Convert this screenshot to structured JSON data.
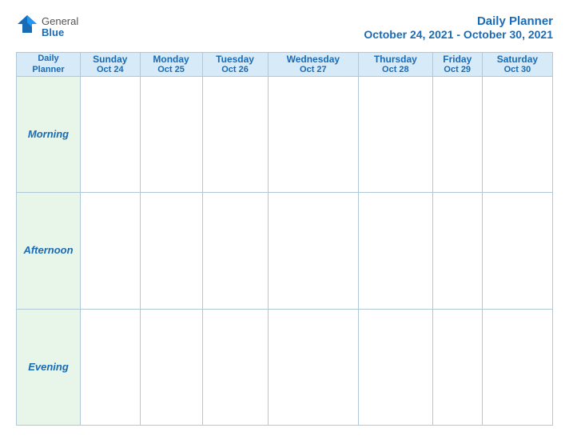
{
  "logo": {
    "general": "General",
    "blue": "Blue",
    "bird_icon": "🐦"
  },
  "title": {
    "line1": "Daily Planner",
    "line2": "October 24, 2021 - October 30, 2021"
  },
  "header_row": {
    "col0": {
      "line1": "Daily",
      "line2": "Planner"
    },
    "col1": {
      "day": "Sunday",
      "date": "Oct 24"
    },
    "col2": {
      "day": "Monday",
      "date": "Oct 25"
    },
    "col3": {
      "day": "Tuesday",
      "date": "Oct 26"
    },
    "col4": {
      "day": "Wednesday",
      "date": "Oct 27"
    },
    "col5": {
      "day": "Thursday",
      "date": "Oct 28"
    },
    "col6": {
      "day": "Friday",
      "date": "Oct 29"
    },
    "col7": {
      "day": "Saturday",
      "date": "Oct 30"
    }
  },
  "rows": {
    "morning": "Morning",
    "afternoon": "Afternoon",
    "evening": "Evening"
  }
}
